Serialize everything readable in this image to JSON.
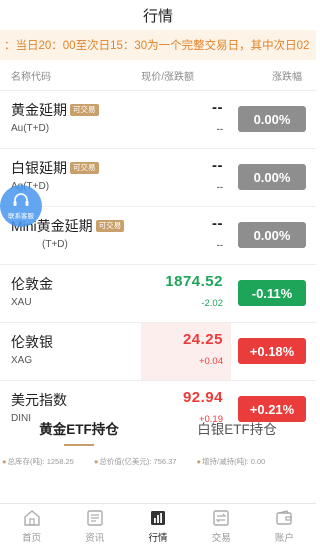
{
  "header": {
    "title": "行情"
  },
  "notice": {
    "text": "：当日20：00至次日15：30为一个完整交易日，其中次日02"
  },
  "columns": {
    "name": "名称代码",
    "price": "现价/涨跌额",
    "pct": "涨跌幅"
  },
  "rows": [
    {
      "name": "黄金延期",
      "tag": "可交易",
      "code": "Au(T+D)",
      "price": "--",
      "change": "--",
      "pct": "0.00%",
      "trend": "flat"
    },
    {
      "name": "白银延期",
      "tag": "可交易",
      "code": "Ag(T+D)",
      "price": "--",
      "change": "--",
      "pct": "0.00%",
      "trend": "flat"
    },
    {
      "name": "Mini黄金延期",
      "tag": "可交易",
      "code": "(T+D)",
      "price": "--",
      "change": "--",
      "pct": "0.00%",
      "trend": "flat"
    },
    {
      "name": "伦敦金",
      "tag": "",
      "code": "XAU",
      "price": "1874.52",
      "change": "-2.02",
      "pct": "-0.11%",
      "trend": "down"
    },
    {
      "name": "伦敦银",
      "tag": "",
      "code": "XAG",
      "price": "24.25",
      "change": "+0.04",
      "pct": "+0.18%",
      "trend": "up"
    },
    {
      "name": "美元指数",
      "tag": "",
      "code": "DINI",
      "price": "92.94",
      "change": "+0.19",
      "pct": "+0.21%",
      "trend": "up"
    }
  ],
  "float_service": {
    "label": "联系客服"
  },
  "etf_tabs": [
    {
      "label": "黄金ETF持仓",
      "active": true
    },
    {
      "label": "白银ETF持仓",
      "active": false
    }
  ],
  "etf_stats": {
    "total_hold": "总库存(吨): 1258.25",
    "total_value": "总价值(亿美元): 756.37",
    "change": "增持/减持(吨): 0.00"
  },
  "tabbar": [
    {
      "label": "首页",
      "icon": "home-icon",
      "active": false
    },
    {
      "label": "资讯",
      "icon": "news-icon",
      "active": false
    },
    {
      "label": "行情",
      "icon": "chart-icon",
      "active": true
    },
    {
      "label": "交易",
      "icon": "trade-icon",
      "active": false
    },
    {
      "label": "账户",
      "icon": "wallet-icon",
      "active": false
    }
  ],
  "colors": {
    "up": "#ea3c3a",
    "down": "#1ea55a",
    "flat": "#8e8e8e",
    "accent": "#c8a06b",
    "notice": "#e1832b"
  }
}
